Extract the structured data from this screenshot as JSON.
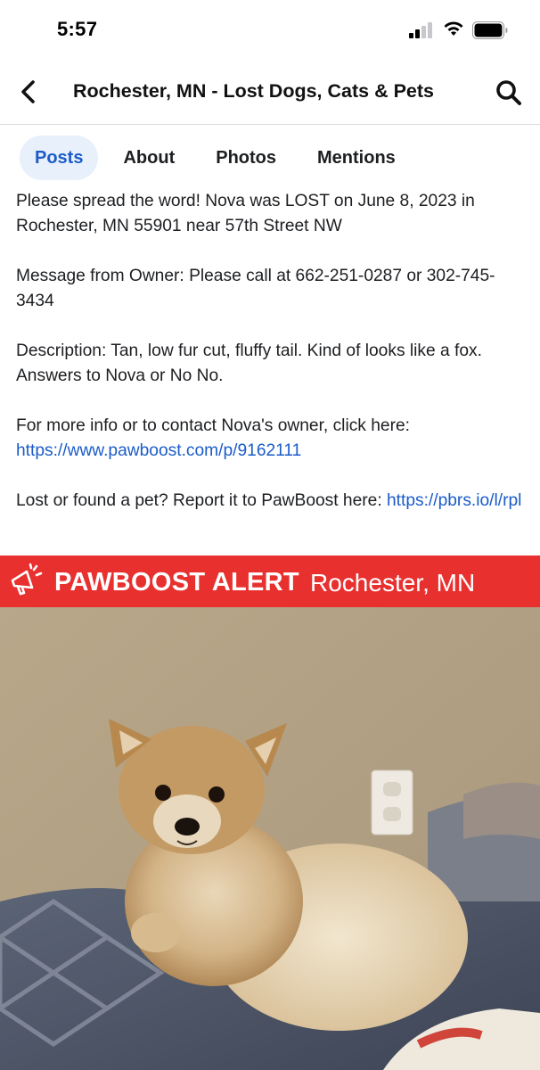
{
  "status_bar": {
    "time": "5:57"
  },
  "header": {
    "title": "Rochester, MN - Lost Dogs, Cats & Pets",
    "back_icon": "chevron-left-icon",
    "search_icon": "search-icon"
  },
  "tabs": [
    {
      "label": "Posts",
      "active": true
    },
    {
      "label": "About",
      "active": false
    },
    {
      "label": "Photos",
      "active": false
    },
    {
      "label": "Mentions",
      "active": false
    }
  ],
  "post": {
    "para1": "Please spread the word! Nova was LOST on June 8, 2023 in Rochester, MN 55901 near 57th Street NW",
    "para2": "Message from Owner: Please call at 662-251-0287 or 302-745-3434",
    "para3": "Description: Tan, low fur cut, fluffy tail. Kind of looks like a fox. Answers to Nova or No No.",
    "para4_text": "For more info or to contact Nova's owner, click here:",
    "para4_link": "https://www.pawboost.com/p/9162111",
    "para5_text": "Lost or found a pet? Report it to PawBoost here:",
    "para5_link": "https://pbrs.io/l/rpl"
  },
  "alert": {
    "title": "PAWBOOST ALERT",
    "location": "Rochester, MN",
    "color": "#e8302f"
  },
  "colors": {
    "link": "#1b5cc8",
    "active_tab_bg": "#e7f0fb"
  }
}
